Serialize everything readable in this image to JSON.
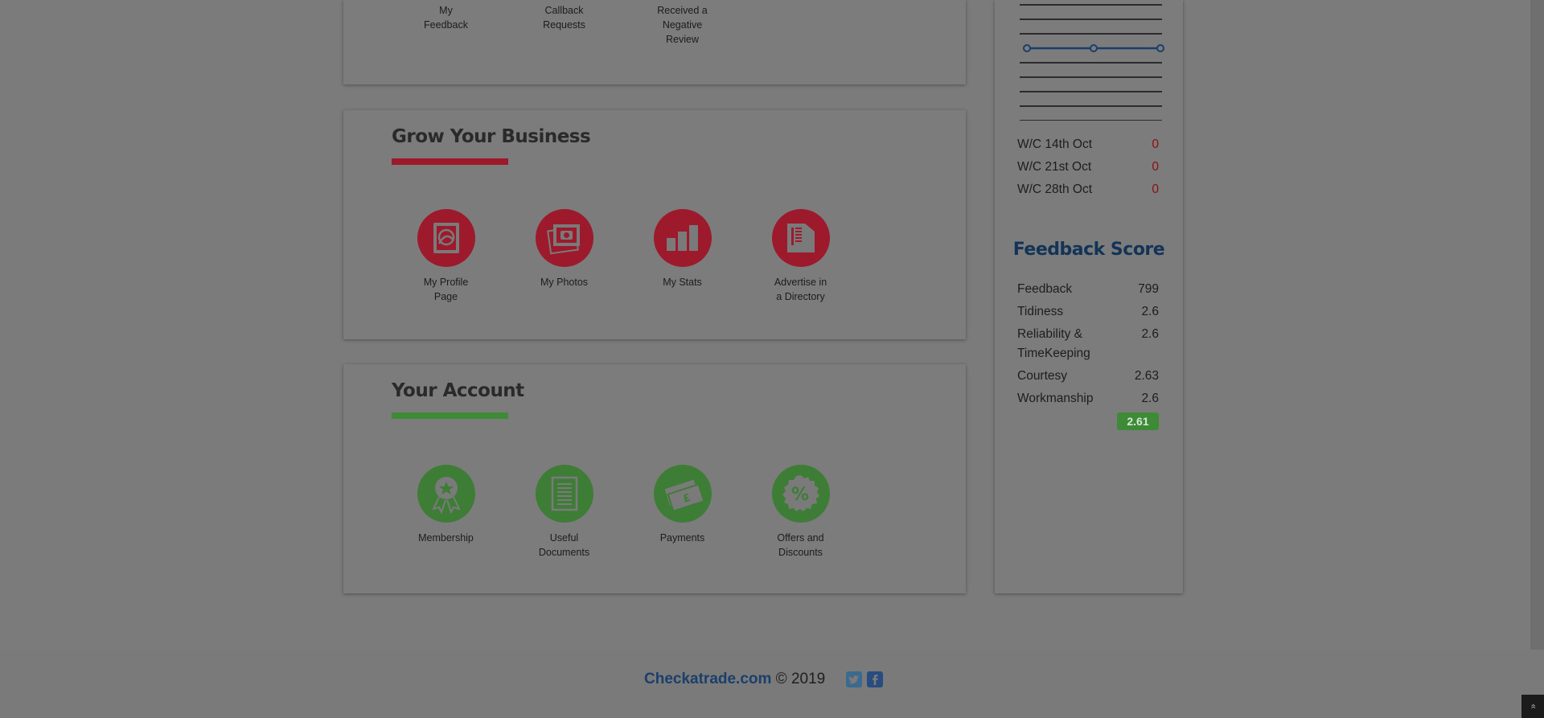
{
  "top_section": {
    "items": [
      {
        "label": "My\nFeedback"
      },
      {
        "label": "Callback\nRequests"
      },
      {
        "label": "Received a\nNegative\nReview"
      }
    ]
  },
  "grow": {
    "title": "Grow Your Business",
    "items": [
      {
        "label": "My Profile\nPage",
        "icon": "profile-page-icon"
      },
      {
        "label": "My Photos",
        "icon": "photos-icon"
      },
      {
        "label": "My Stats",
        "icon": "stats-icon"
      },
      {
        "label": "Advertise in\na Directory",
        "icon": "directory-icon"
      }
    ]
  },
  "account": {
    "title": "Your Account",
    "items": [
      {
        "label": "Membership",
        "icon": "membership-award-icon"
      },
      {
        "label": "Useful\nDocuments",
        "icon": "documents-icon"
      },
      {
        "label": "Payments",
        "icon": "payments-icon"
      },
      {
        "label": "Offers and\nDiscounts",
        "icon": "discount-icon"
      }
    ]
  },
  "sidebar": {
    "weeks": [
      {
        "label": "W/C 14th Oct",
        "value": "0"
      },
      {
        "label": "W/C 21st Oct",
        "value": "0"
      },
      {
        "label": "W/C 28th Oct",
        "value": "0"
      }
    ],
    "feedback_score": {
      "title": "Feedback Score",
      "rows": [
        {
          "label": "Feedback",
          "value": "799"
        },
        {
          "label": "Tidiness",
          "value": "2.6"
        },
        {
          "label": "Reliability &\nTimeKeeping",
          "value": "2.6"
        },
        {
          "label": "Courtesy",
          "value": "2.63"
        },
        {
          "label": "Workmanship",
          "value": "2.6"
        }
      ],
      "total": "2.61"
    }
  },
  "footer": {
    "brand": "Checkatrade.com",
    "copyright": " © 2019"
  },
  "colors": {
    "red": "#9c1a2b",
    "green": "#3d8a37",
    "navy": "#133456"
  }
}
